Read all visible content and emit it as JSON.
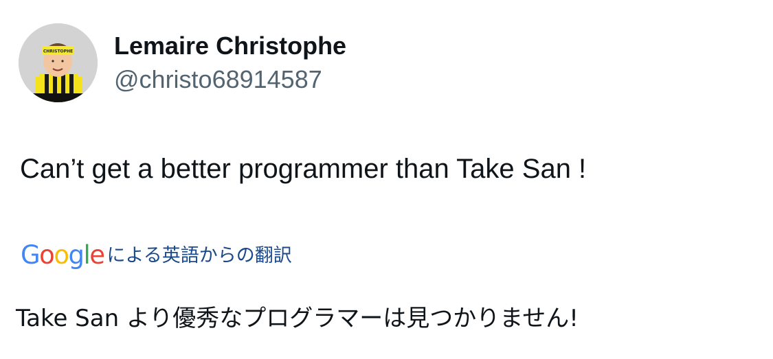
{
  "author": {
    "display_name": "Lemaire Christophe",
    "handle": "@christo68914587",
    "avatar_headband_text": "CHRISTOPHE"
  },
  "tweet": {
    "text": "Can’t get a better programmer than Take San !"
  },
  "translation": {
    "google_letters": [
      "G",
      "o",
      "o",
      "g",
      "l",
      "e"
    ],
    "google_colors": [
      "#4285F4",
      "#EA4335",
      "#FBBC05",
      "#4285F4",
      "#34A853",
      "#EA4335"
    ],
    "credit_text": "による英語からの翻訳",
    "credit_color": "#1a4a8a",
    "translated_text": "Take San より優秀なプログラマーは見つかりません!"
  }
}
